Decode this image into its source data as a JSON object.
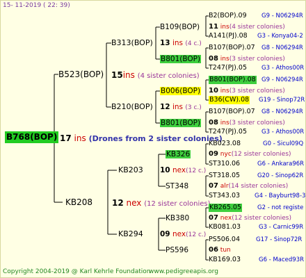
{
  "header": {
    "date": "15- 11-2019 ( 22: 39)"
  },
  "footer": {
    "copyright": "Copyright 2004-2019 @ Karl Kehrle Foundation",
    "site": "www.pedigreeapis.org"
  },
  "root": {
    "name": "B768(BOP)",
    "ins": "17",
    "unit": "ins",
    "note": "(Drones from 2 sister colonies)"
  },
  "g1": {
    "top": {
      "name": "B523(BOP)",
      "ins": "15",
      "unit": "ins",
      "note": "(4 sister colonies)"
    },
    "bottom": {
      "name": "KB208",
      "ins": "12",
      "unit": "nex",
      "note": "(12 sister colonies)"
    }
  },
  "g2": {
    "a": {
      "name": "B313(BOP)",
      "ins": "13",
      "unit": "ins",
      "note": "(4 c.)"
    },
    "b": {
      "name": "B210(BOP)",
      "ins": "12",
      "unit": "ins",
      "note": "(3 c.)"
    },
    "c": {
      "name": "KB203",
      "ins": "10",
      "unit": "nex",
      "note": "(12 c.)"
    },
    "d": {
      "name": "KB294",
      "ins": "09",
      "unit": "nex",
      "note": "(12 c.)"
    }
  },
  "g3": [
    {
      "name": "B109(BOP)",
      "ins": "11",
      "unit": "ins",
      "note": "(4 sister colonies)"
    },
    {
      "name": "B801(BOP)",
      "ins": "08",
      "unit": "ins",
      "note": "(3 sister colonies)"
    },
    {
      "name": "B006(BOP)",
      "ins": "10",
      "unit": "ins",
      "note": "(3 sister colonies)"
    },
    {
      "name": "B801(BOP)",
      "ins": "08",
      "unit": "ins",
      "note": "(3 sister colonies)"
    },
    {
      "name": "KB326",
      "ins": "09",
      "unit": "nyc",
      "note": "(12 sister colonies)"
    },
    {
      "name": "ST348",
      "ins": "07",
      "unit": "alr",
      "note": "(14 sister colonies)"
    },
    {
      "name": "KB380",
      "ins": "07",
      "unit": "nex",
      "note": "(12 sister colonies)"
    },
    {
      "name": "PS596",
      "ins": "06",
      "unit": "tun",
      "note": ""
    }
  ],
  "g4": [
    {
      "name": "B2(BOP).09",
      "ref": "G9 - N06294R"
    },
    {
      "name": "A141(PJ).08",
      "ref": "G3 - Konya04-2"
    },
    {
      "name": "B107(BOP).07",
      "ref": "G8 - N06294R"
    },
    {
      "name": "T247(PJ).05",
      "ref": "G3 - Athos00R"
    },
    {
      "name": "B801(BOP).08",
      "ref": "G9 - N06294R"
    },
    {
      "name": "B36(CW).08",
      "ref": "G19 - Sinop72R"
    },
    {
      "name": "B107(BOP).07",
      "ref": "G8 - N06294R"
    },
    {
      "name": "T247(PJ).05",
      "ref": "G3 - Athos00R"
    },
    {
      "name": "KB023.08",
      "ref": "G0 - Sicul09Q"
    },
    {
      "name": "ST310.06",
      "ref": "G6 - Ankara96R"
    },
    {
      "name": "ST318.05",
      "ref": "G20 - Sinop62R"
    },
    {
      "name": "ST343.03",
      "ref": "G4 - Bayburt98-3"
    },
    {
      "name": "KB265.05",
      "ref": "G2 - not registe"
    },
    {
      "name": "KB081.03",
      "ref": "G3 - Carnic99R"
    },
    {
      "name": "PS506.04",
      "ref": "G17 - Sinop72R"
    },
    {
      "name": "KB169.03",
      "ref": "G6 - Maced93R"
    }
  ],
  "colors": {
    "background": "#ffffe4",
    "highlight_green": "#3ecf3e",
    "highlight_yellow": "#ffff00",
    "ins_red": "#cc0000",
    "ref_blue": "#0000cc"
  }
}
